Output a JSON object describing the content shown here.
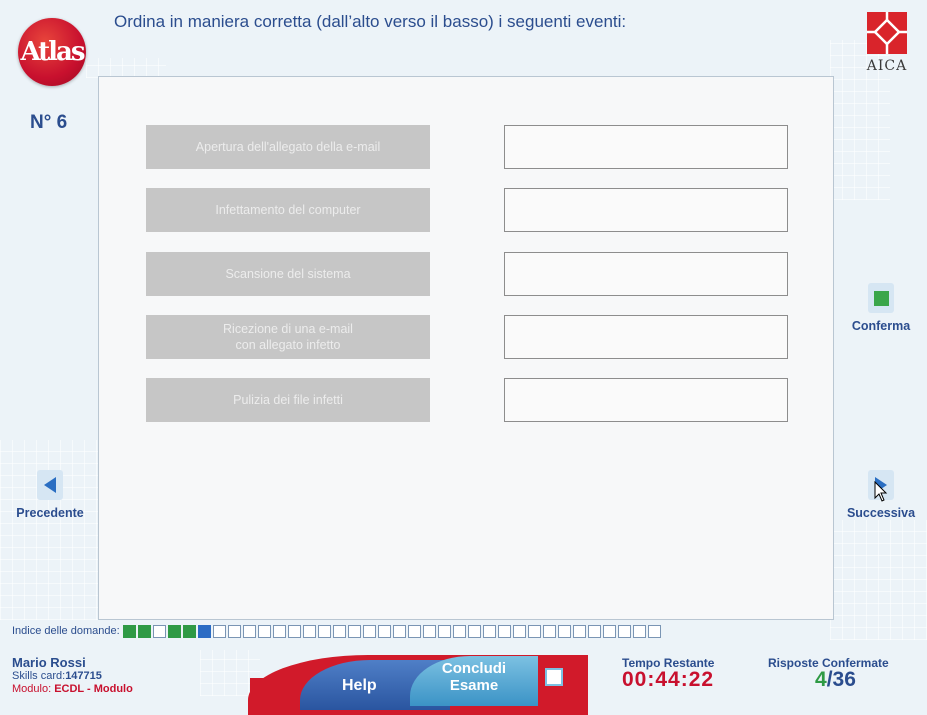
{
  "header": {
    "logo_text": "Atlas",
    "question": "Ordina in maniera corretta (dall’alto verso il basso) i seguenti eventi:",
    "aica_text": "AICA",
    "question_number": "N° 6"
  },
  "items": [
    {
      "label": "Apertura dell'allegato della e-mail"
    },
    {
      "label": "Infettamento del computer"
    },
    {
      "label": "Scansione del sistema"
    },
    {
      "label": "Ricezione di una e-mail\ncon allegato infetto"
    },
    {
      "label": "Pulizia dei file infetti"
    }
  ],
  "nav": {
    "confirm_label": "Conferma",
    "prev_label": "Precedente",
    "next_label": "Successiva"
  },
  "index": {
    "label": "Indice delle domande:",
    "states": [
      "g",
      "g",
      "e",
      "g",
      "g",
      "b",
      "e",
      "e",
      "e",
      "e",
      "e",
      "e",
      "e",
      "e",
      "e",
      "e",
      "e",
      "e",
      "e",
      "e",
      "e",
      "e",
      "e",
      "e",
      "e",
      "e",
      "e",
      "e",
      "e",
      "e",
      "e",
      "e",
      "e",
      "e",
      "e",
      "e"
    ]
  },
  "footer": {
    "user_name": "Mario Rossi",
    "skills_label": "Skills card:",
    "skills_value": "147715",
    "module_label": "Modulo:",
    "module_value": "ECDL - Modulo",
    "help_label": "Help",
    "end_label": "Concludi\nEsame",
    "time_label": "Tempo Restante",
    "time_value": "00:44:22",
    "confirmed_label": "Risposte Confermate",
    "confirmed_current": "4",
    "confirmed_total": "/36"
  },
  "colors": {
    "accent_blue": "#2b4d8e",
    "brand_red": "#c8102e",
    "confirmed_green": "#2f9a45"
  }
}
